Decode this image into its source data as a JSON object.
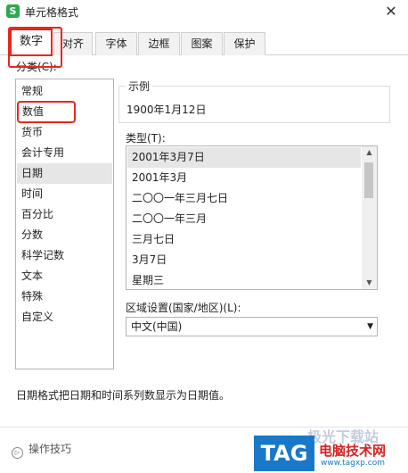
{
  "window": {
    "title": "单元格格式",
    "app_icon_letter": "S",
    "close_glyph": "✕"
  },
  "tabs": [
    {
      "label": "数字",
      "active": true
    },
    {
      "label": "对齐",
      "active": false
    },
    {
      "label": "字体",
      "active": false
    },
    {
      "label": "边框",
      "active": false
    },
    {
      "label": "图案",
      "active": false
    },
    {
      "label": "保护",
      "active": false
    }
  ],
  "category": {
    "label": "分类(C):",
    "items": [
      "常规",
      "数值",
      "货币",
      "会计专用",
      "日期",
      "时间",
      "百分比",
      "分数",
      "科学记数",
      "文本",
      "特殊",
      "自定义"
    ],
    "selected": "日期",
    "highlighted": "数值"
  },
  "sample": {
    "label": "示例",
    "value": "1900年1月12日"
  },
  "type": {
    "label": "类型(T):",
    "items": [
      "2001年3月7日",
      "2001年3月",
      "二〇〇一年三月七日",
      "二〇〇一年三月",
      "三月七日",
      "3月7日",
      "星期三"
    ],
    "selected": "2001年3月7日",
    "scroll_up": "▲",
    "scroll_down": "▼"
  },
  "region": {
    "label": "区域设置(国家/地区)(L):",
    "value": "中文(中国)",
    "arrow": "▼"
  },
  "description": "日期格式把日期和时间系列数显示为日期值。",
  "footer": {
    "tips_label": "操作技巧",
    "tips_icon": "▷"
  },
  "watermark": {
    "logo": "TAG",
    "site": "电脑技术网",
    "url": "www.tagxp.com",
    "faded": "极光下载站"
  },
  "colors": {
    "highlight": "#e8271d",
    "app_icon": "#2fa84f",
    "selection": "#e6e6e6"
  }
}
